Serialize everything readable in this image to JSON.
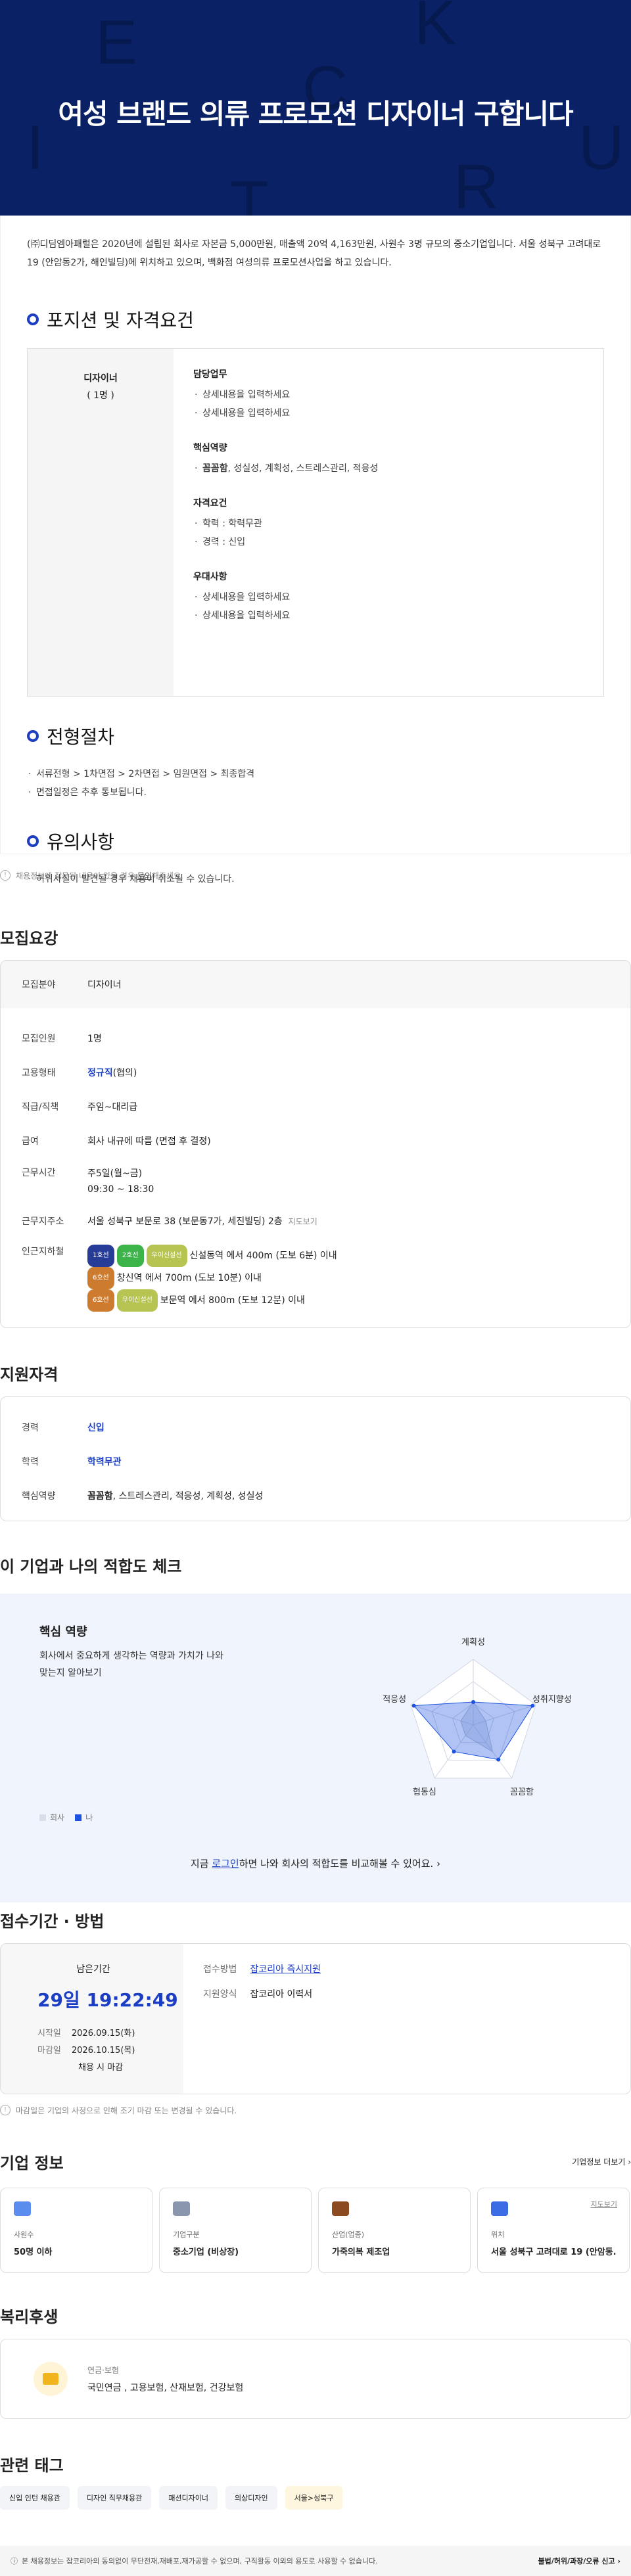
{
  "hero": {
    "title": "여성 브랜드 의류 프로모션 디자이너 구합니다",
    "decor_letters": [
      "E",
      "K",
      "I",
      "C",
      "R",
      "U",
      "T"
    ]
  },
  "intro": "(㈜디딤엠아패럴은 2020년에 설립된 회사로 자본금 5,000만원, 매출액 20억 4,163만원, 사원수 3명 규모의 중소기업입니다. 서울 성북구 고려대로 19 (안암동2가, 해인빌딩)에 위치하고 있으며, 백화점 여성의류 프로모션사업을 하고 있습니다.",
  "position": {
    "heading": "포지션 및 자격요건",
    "role": "디자이너",
    "count": "( 1명 )",
    "groups": [
      {
        "title": "담당업무",
        "items": [
          "상세내용을 입력하세요",
          "상세내용을 입력하세요"
        ]
      },
      {
        "title": "핵심역량",
        "items": [
          "꼼꼼함, 성실성, 계획성, 스트레스관리, 적응성"
        ]
      },
      {
        "title": "자격요건",
        "items": [
          "학력 : 학력무관",
          "경력 : 신입"
        ]
      },
      {
        "title": "우대사항",
        "items": [
          "상세내용을 입력하세요",
          "상세내용을 입력하세요"
        ]
      }
    ]
  },
  "process": {
    "heading": "전형절차",
    "items": [
      "서류전형 > 1차면접 > 2차면접 > 임원면접 > 최종합격",
      "면접일정은 추후 통보됩니다."
    ]
  },
  "caution": {
    "heading": "유의사항",
    "items": [
      "허위사실이 발견될 경우 채용이 취소될 수 있습니다."
    ]
  },
  "report_notice": {
    "text": "채용정보에 잘못된 내용이 있을 경우",
    "link": "문의",
    "suffix": "해주세요."
  },
  "recruit": {
    "heading": "모집요강",
    "field_label": "모집분야",
    "field_value": "디자이너",
    "rows": [
      {
        "k": "모집인원",
        "v": "1명"
      },
      {
        "k": "고용형태",
        "v": "정규직",
        "v2": "(협의)"
      },
      {
        "k": "직급/직책",
        "v": "주임~대리급"
      },
      {
        "k": "급여",
        "v": "회사 내규에 따름 (면접 후 결정)"
      }
    ],
    "work_time_label": "근무시간",
    "work_time": [
      "주5일(월~금)",
      "09:30 ~ 18:30"
    ],
    "address_label": "근무지주소",
    "address": "서울 성북구 보문로 38 (보문동7가, 세진빌딩) 2층",
    "map_link": "지도보기",
    "station_label": "인근지하철",
    "stations": [
      {
        "badges": [
          {
            "t": "1호선",
            "c": "#263c96"
          },
          {
            "t": "2호선",
            "c": "#3cb44a"
          },
          {
            "t": "우이신설선",
            "c": "#b7c452"
          }
        ],
        "text": "신설동역 에서 400m (도보 6분) 이내"
      },
      {
        "badges": [
          {
            "t": "6호선",
            "c": "#cd7c2f"
          }
        ],
        "text": "창신역 에서 700m (도보 10분) 이내"
      },
      {
        "badges": [
          {
            "t": "6호선",
            "c": "#cd7c2f"
          },
          {
            "t": "우이신설선",
            "c": "#b7c452"
          }
        ],
        "text": "보문역 에서 800m (도보 12분) 이내"
      }
    ]
  },
  "qual": {
    "heading": "지원자격",
    "rows": [
      {
        "k": "경력",
        "v": "신입"
      },
      {
        "k": "학력",
        "v": "학력무관"
      }
    ],
    "core_label": "핵심역량",
    "core_bold": "꼼꼼함",
    "core_rest": ", 스트레스관리, 적응성, 계획성, 성실성"
  },
  "fit": {
    "heading": "이 기업과 나의 적합도 체크",
    "title": "핵심 역량",
    "desc": "회사에서 중요하게 생각하는 역량과 가치가 나와 맞는지 알아보기",
    "legend": [
      "회사",
      "나"
    ],
    "axes": [
      "계획성",
      "성취지향성",
      "꼼꼼함",
      "협동심",
      "적응성"
    ],
    "chart_data": {
      "type": "radar",
      "axes": [
        "계획성",
        "성취지향성",
        "꼼꼼함",
        "협동심",
        "적응성"
      ],
      "series": [
        {
          "name": "회사",
          "values": [
            0.35,
            0.2,
            0.5,
            0.2,
            0.2
          ]
        },
        {
          "name": "나",
          "values": [
            0.35,
            0.95,
            0.65,
            0.5,
            0.95
          ]
        }
      ]
    },
    "cta_pre": "지금",
    "cta_link": "로그인",
    "cta_post": "하면 나와 회사의 적합도를 비교해볼 수 있어요."
  },
  "period": {
    "heading": "접수기간 · 방법",
    "remain_label": "남은기간",
    "remain": "29일 19:22:49",
    "start_label": "시작일",
    "start": "2026.09.15(화)",
    "end_label": "마감일",
    "end": "2026.10.15(목)",
    "end_note": "채용 시 마감",
    "method_label": "접수방법",
    "method": "잡코리아 즉시지원",
    "form_label": "지원양식",
    "form": "잡코리아 이력서",
    "notice": "마감일은 기업의 사정으로 인해 조기 마감 또는 변경될 수 있습니다."
  },
  "company": {
    "heading": "기업 정보",
    "more": "기업정보 더보기",
    "cards": [
      {
        "icon": "people-icon",
        "label": "사원수",
        "value": "50명 이하",
        "color": "#5b8def"
      },
      {
        "icon": "building-icon",
        "label": "기업구분",
        "value": "중소기업 (비상장)",
        "color": "#8a96ad"
      },
      {
        "icon": "briefcase-icon",
        "label": "산업(업종)",
        "value": "가죽의복 제조업",
        "color": "#8b4a1f"
      },
      {
        "icon": "location-icon",
        "label": "위치",
        "value": "서울 성북구 고려대로 19 (안암동...",
        "color": "#3b6ce6",
        "extra": "지도보기"
      }
    ]
  },
  "welfare": {
    "heading": "복리후생",
    "title": "연금·보험",
    "value": "국민연금 , 고용보험, 산재보험, 건강보험"
  },
  "tags": {
    "heading": "관련 태그",
    "items": [
      "신입 인턴 채용관",
      "디자인 직무채용관",
      "패션디자이너",
      "의상디자인",
      "서울>성북구"
    ]
  },
  "footer": {
    "text": "본 채용정보는 잡코리아의 동의없이 무단전재,재배포,재가공할 수 없으며, 구직활동 이외의 용도로 사용할 수 없습니다.",
    "report": "불법/허위/과장/오류 신고"
  }
}
